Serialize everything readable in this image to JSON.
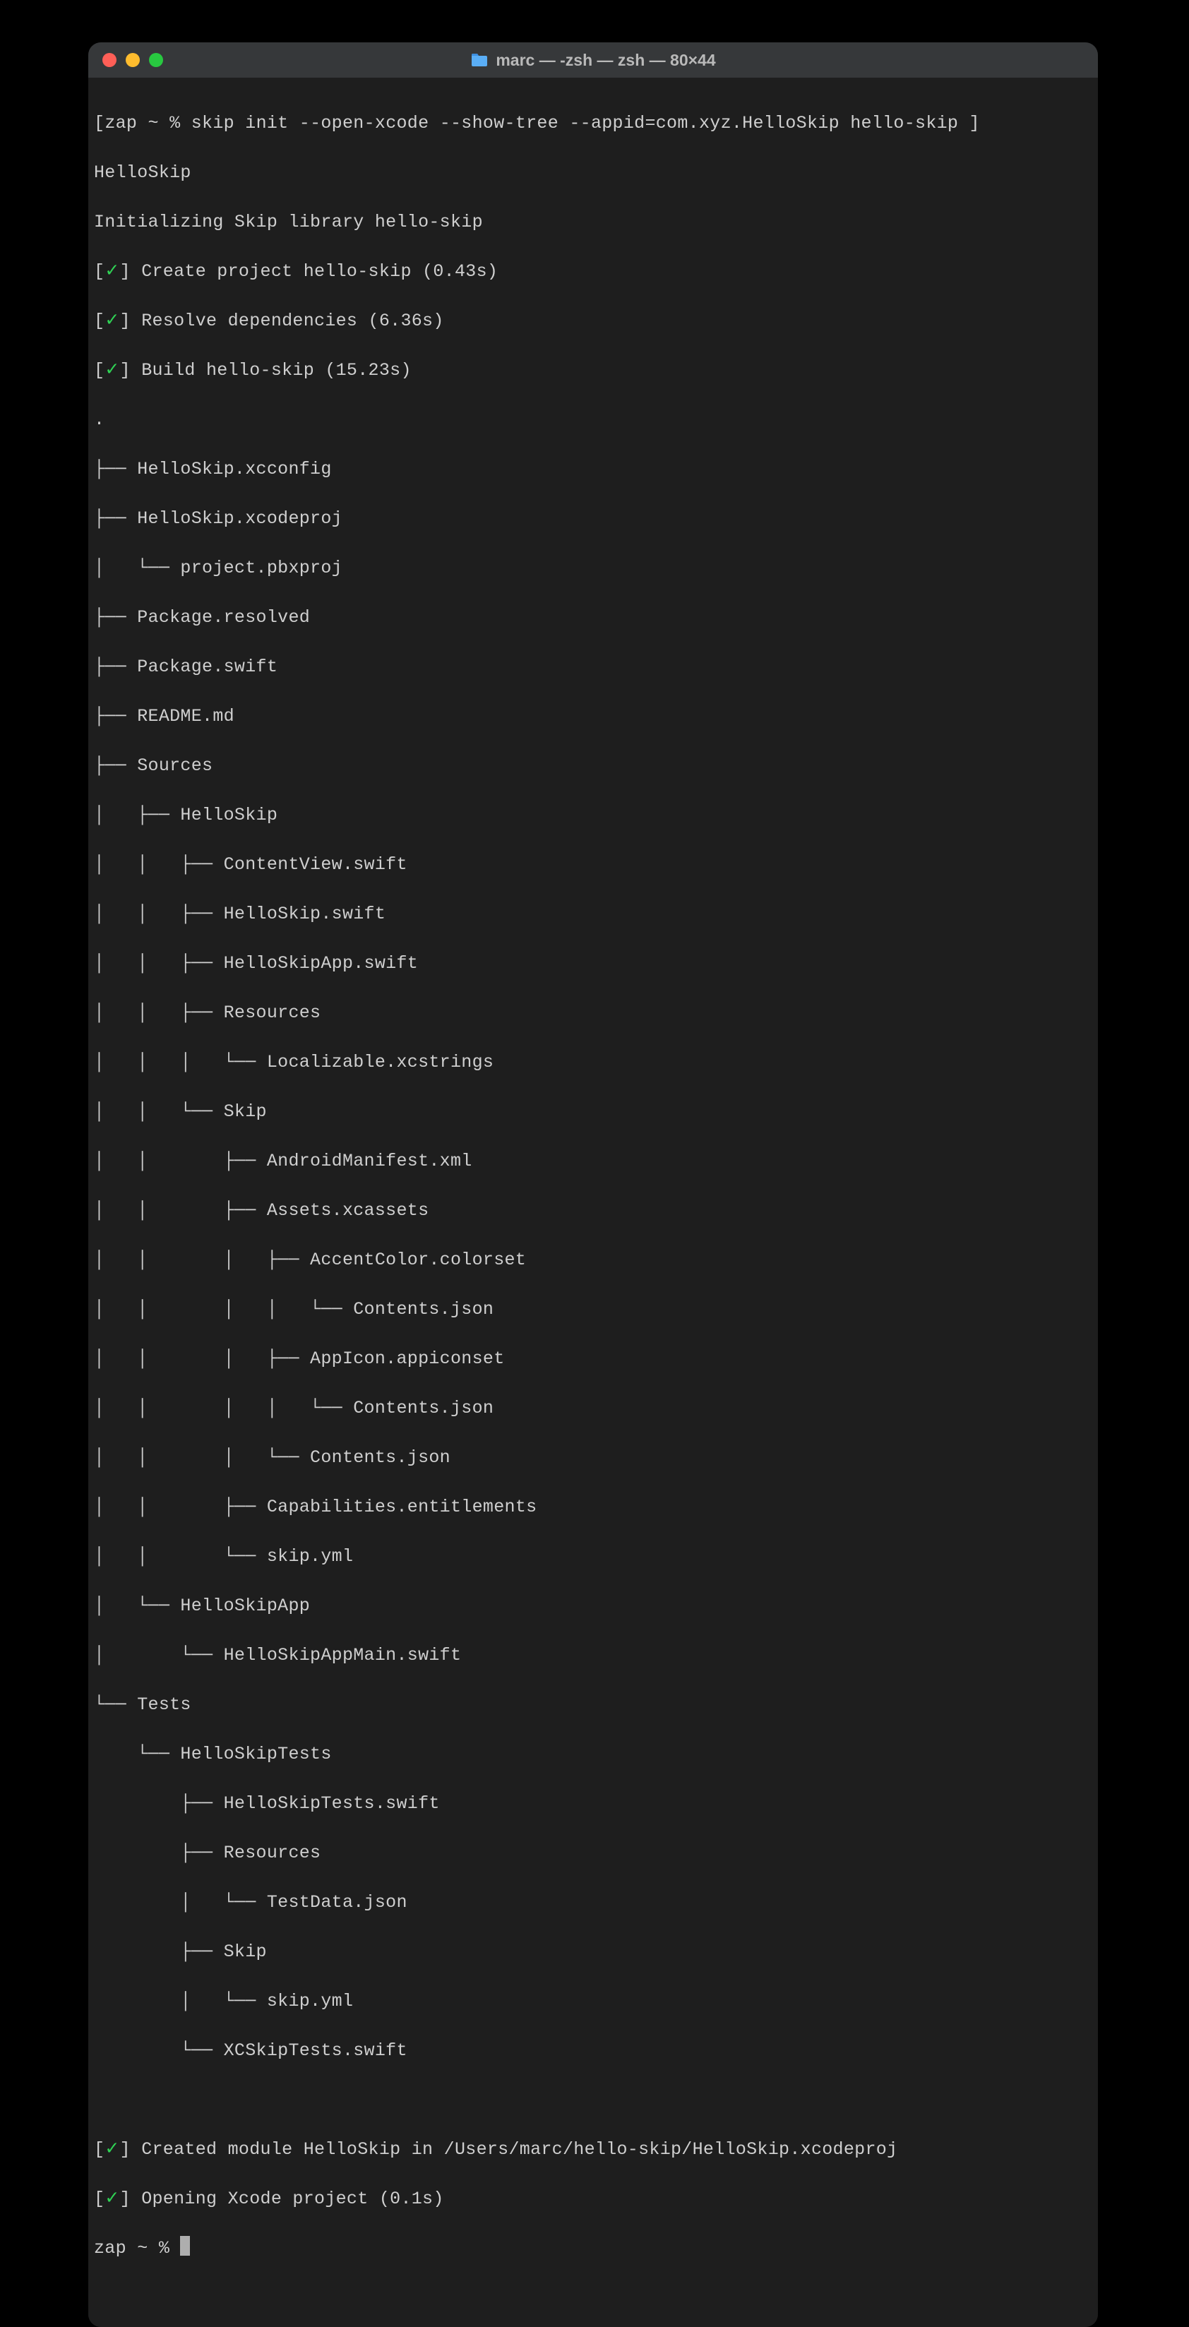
{
  "window": {
    "title": "marc — -zsh — zsh — 80×44"
  },
  "prompt1": {
    "host": "zap ~ %",
    "command": "skip init --open-xcode --show-tree --appid=com.xyz.HelloSkip hello-skip"
  },
  "output": {
    "project": "HelloSkip",
    "initLine": "Initializing Skip library hello-skip",
    "steps": {
      "create": "Create project hello-skip (0.43s)",
      "resolve": "Resolve dependencies (6.36s)",
      "build": "Build hello-skip (15.23s)",
      "created": "Created module HelloSkip in /Users/marc/hello-skip/HelloSkip.xcodeproj",
      "opening": "Opening Xcode project (0.1s)"
    },
    "tree": {
      "dot": ".",
      "l01": "├── HelloSkip.xcconfig",
      "l02": "├── HelloSkip.xcodeproj",
      "l03": "│   └── project.pbxproj",
      "l04": "├── Package.resolved",
      "l05": "├── Package.swift",
      "l06": "├── README.md",
      "l07": "├── Sources",
      "l08": "│   ├── HelloSkip",
      "l09": "│   │   ├── ContentView.swift",
      "l10": "│   │   ├── HelloSkip.swift",
      "l11": "│   │   ├── HelloSkipApp.swift",
      "l12": "│   │   ├── Resources",
      "l13": "│   │   │   └── Localizable.xcstrings",
      "l14": "│   │   └── Skip",
      "l15": "│   │       ├── AndroidManifest.xml",
      "l16": "│   │       ├── Assets.xcassets",
      "l17": "│   │       │   ├── AccentColor.colorset",
      "l18": "│   │       │   │   └── Contents.json",
      "l19": "│   │       │   ├── AppIcon.appiconset",
      "l20": "│   │       │   │   └── Contents.json",
      "l21": "│   │       │   └── Contents.json",
      "l22": "│   │       ├── Capabilities.entitlements",
      "l23": "│   │       └── skip.yml",
      "l24": "│   └── HelloSkipApp",
      "l25": "│       └── HelloSkipAppMain.swift",
      "l26": "└── Tests",
      "l27": "    └── HelloSkipTests",
      "l28": "        ├── HelloSkipTests.swift",
      "l29": "        ├── Resources",
      "l30": "        │   └── TestData.json",
      "l31": "        ├── Skip",
      "l32": "        │   └── skip.yml",
      "l33": "        └── XCSkipTests.swift"
    }
  },
  "prompt2": {
    "host": "zap ~ %"
  }
}
